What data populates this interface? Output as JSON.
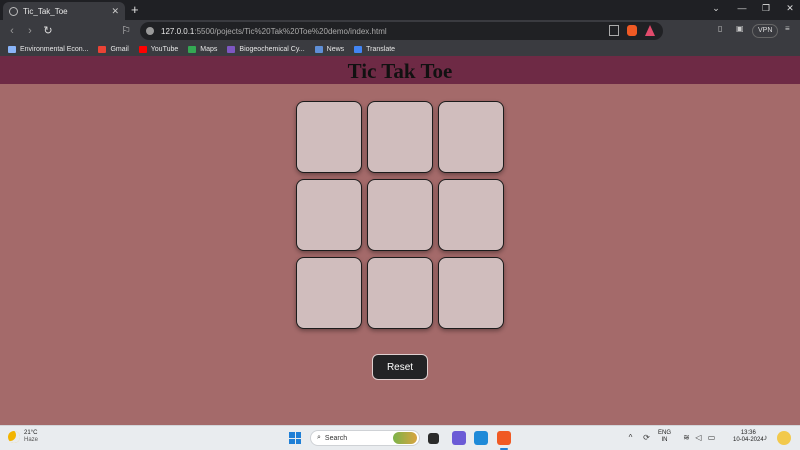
{
  "browser": {
    "tab_title": "Tic_Tak_Toe",
    "tab_close": "✕",
    "new_tab": "+",
    "url_host": "127.0.0.1",
    "url_rest": ":5500/pojects/Tic%20Tak%20Toe%20demo/index.html",
    "vpn_label": "VPN",
    "bookmarks": [
      {
        "label": "Environmental Econ...",
        "color": "#8ab4f8"
      },
      {
        "label": "Gmail",
        "color": "#ea4335"
      },
      {
        "label": "YouTube",
        "color": "#ff0000"
      },
      {
        "label": "Maps",
        "color": "#34a853"
      },
      {
        "label": "Biogeochemical Cy...",
        "color": "#7e57c2"
      },
      {
        "label": "News",
        "color": "#5f8fd6"
      },
      {
        "label": "Translate",
        "color": "#4285f4"
      }
    ]
  },
  "page": {
    "title": "Tic Tak Toe",
    "reset_label": "Reset",
    "cells": [
      "",
      "",
      "",
      "",
      "",
      "",
      "",
      "",
      ""
    ],
    "colors": {
      "background": "#a46a6a",
      "header": "#6e2a45",
      "cell": "#d0bdbd",
      "reset_button": "#232325"
    }
  },
  "taskbar": {
    "temperature": "21°C",
    "condition": "Haze",
    "search_label": "Search",
    "lang_1": "ENG",
    "lang_2": "IN",
    "time": "13:36",
    "date": "10-04-2024"
  }
}
